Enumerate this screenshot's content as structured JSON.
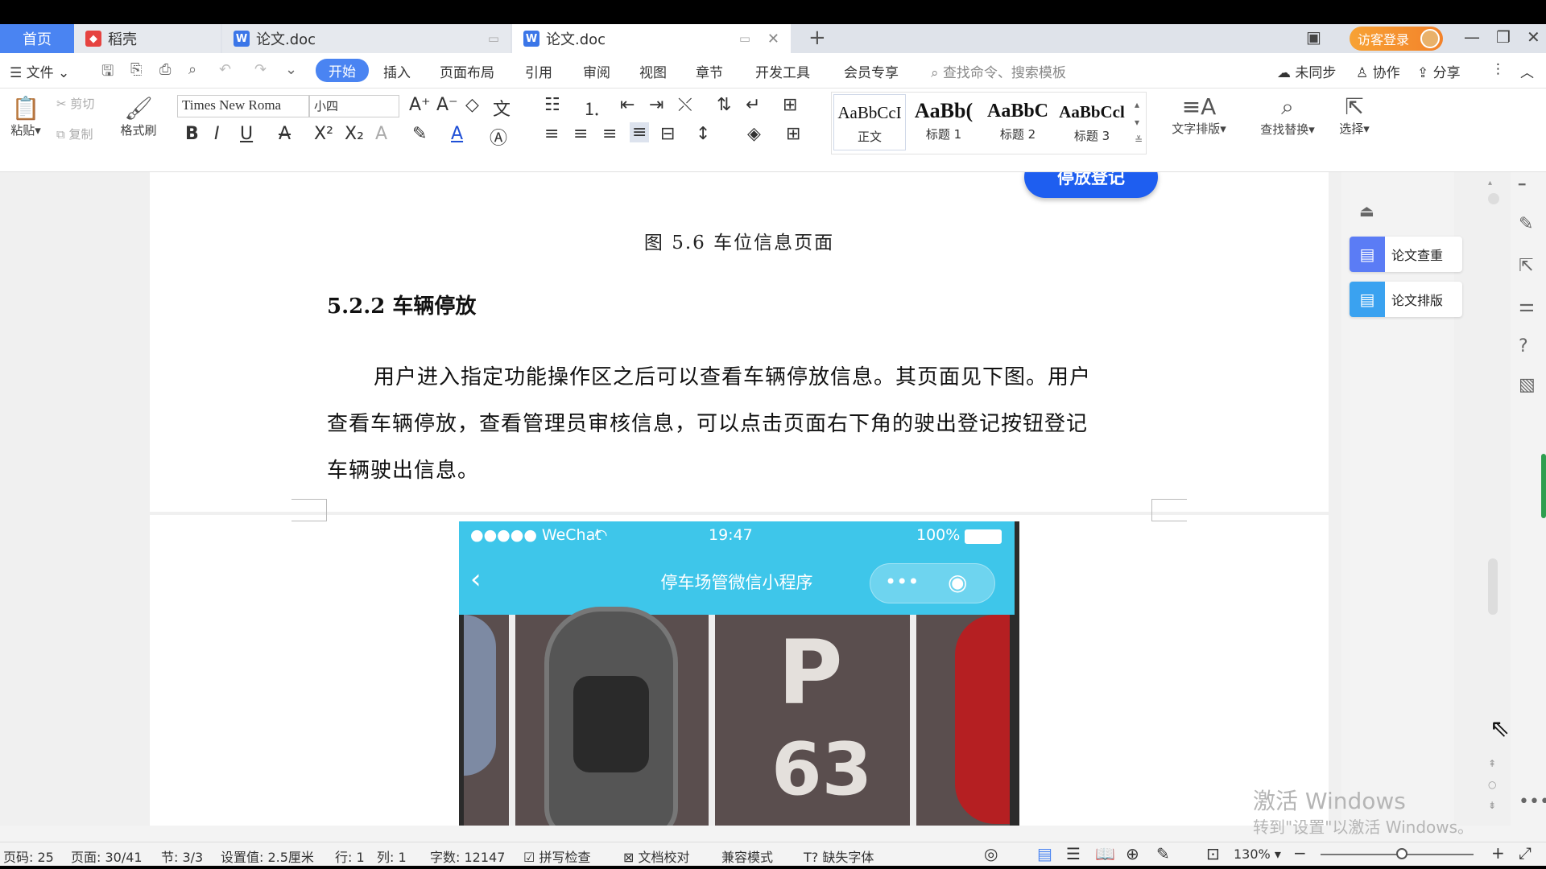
{
  "tabs": {
    "home": "首页",
    "daoke": "稻壳",
    "doc1": "论文.doc",
    "doc2": "论文.doc",
    "add": "+"
  },
  "login": "访客登录",
  "menu": {
    "file": "文件",
    "items": [
      "开始",
      "插入",
      "页面布局",
      "引用",
      "审阅",
      "视图",
      "章节",
      "开发工具",
      "会员专享"
    ],
    "search": "查找命令、搜索模板",
    "sync": "未同步",
    "collab": "协作",
    "share": "分享"
  },
  "ribbon": {
    "paste": "粘贴",
    "cut": "剪切",
    "copy": "复制",
    "format_painter": "格式刷",
    "font": "Times New Roma",
    "size": "小四",
    "styles": [
      {
        "sample": "AaBbCcI",
        "name": "正文"
      },
      {
        "sample": "AaBb(",
        "name": "标题 1"
      },
      {
        "sample": "AaBbC",
        "name": "标题 2"
      },
      {
        "sample": "AaBbCcl",
        "name": "标题 3"
      }
    ],
    "text_layout": "文字排版",
    "find_replace": "查找替换",
    "select": "选择"
  },
  "doc": {
    "button_partial": "停放登记",
    "caption": "图 5.6  车位信息页面",
    "heading": "5.2.2  车辆停放",
    "para_line1": "用户进入指定功能操作区之后可以查看车辆停放信息。其页面见下图。用户",
    "para_line2": "查看车辆停放，查看管理员审核信息，可以点击页面右下角的驶出登记按钮登记",
    "para_line3": "车辆驶出信息。"
  },
  "phone": {
    "carrier": "●●●●● WeChat",
    "time": "19:47",
    "battery": "100%",
    "title": "停车场管微信小程序",
    "spot_letter": "P",
    "spot_number": "63"
  },
  "side": {
    "check": "论文查重",
    "format": "论文排版"
  },
  "watermark": {
    "line1": "激活 Windows",
    "line2": "转到\"设置\"以激活 Windows。"
  },
  "status": {
    "page_code": "页码: 25",
    "page": "页面: 30/41",
    "section": "节: 3/3",
    "setting": "设置值: 2.5厘米",
    "row": "行: 1",
    "col": "列: 1",
    "words": "字数: 12147",
    "spell": "拼写检查",
    "proof": "文档校对",
    "compat": "兼容模式",
    "missing_font": "缺失字体",
    "zoom": "130%"
  }
}
